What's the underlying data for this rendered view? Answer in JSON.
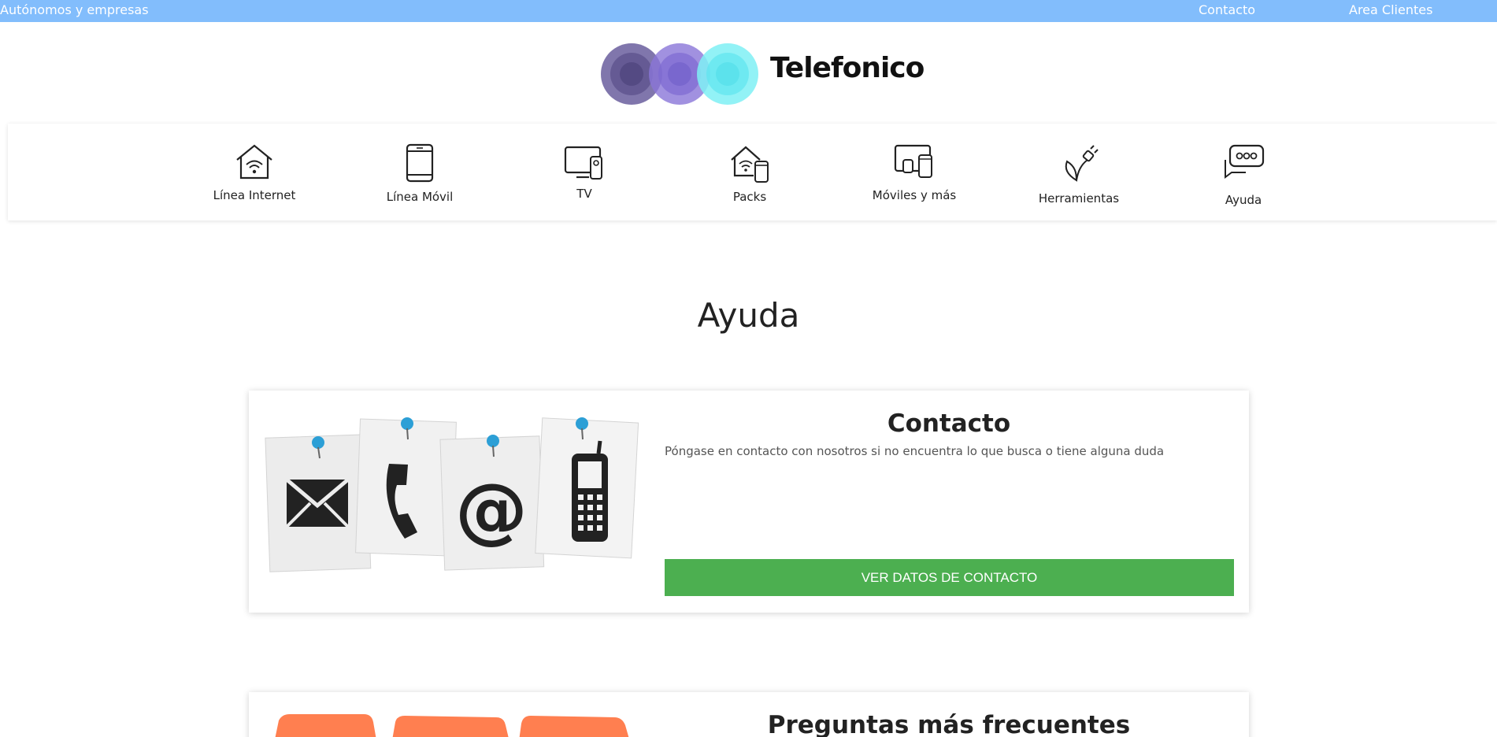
{
  "topbar": {
    "segment_label": "Autónomos y empresas",
    "contact_link": "Contacto",
    "client_area_link": "Area Clientes"
  },
  "brand": {
    "name": "Telefonico",
    "colors": {
      "topbar": "#82bdfc",
      "button": "#4caf50"
    }
  },
  "nav": {
    "items": [
      {
        "label": "Línea Internet",
        "icon": "wifi-house-icon"
      },
      {
        "label": "Línea Móvil",
        "icon": "smartphone-icon"
      },
      {
        "label": "TV",
        "icon": "tv-remote-icon"
      },
      {
        "label": "Packs",
        "icon": "house-phone-pack-icon"
      },
      {
        "label": "Móviles y más",
        "icon": "devices-icon"
      },
      {
        "label": "Herramientas",
        "icon": "plant-plug-icon"
      },
      {
        "label": "Ayuda",
        "icon": "chat-bubbles-icon"
      }
    ]
  },
  "page": {
    "title": "Ayuda"
  },
  "cards": [
    {
      "title": "Contacto",
      "description": "Póngase en contacto con nosotros si no encuentra lo que busca o tiene alguna duda",
      "button": "VER DATOS DE CONTACTO"
    },
    {
      "title": "Preguntas más frecuentes"
    }
  ]
}
